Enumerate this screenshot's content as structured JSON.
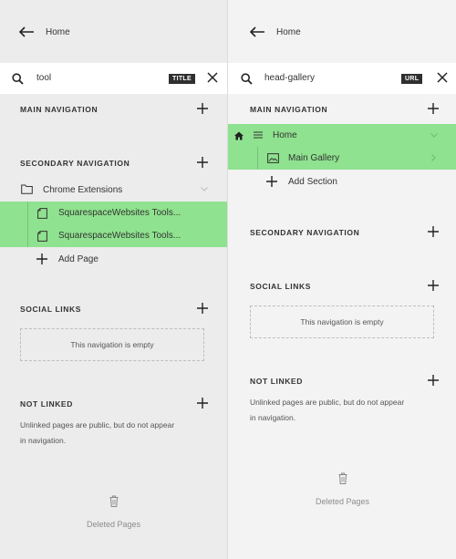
{
  "left": {
    "back_label": "Home",
    "search": {
      "query": "tool",
      "tag": "TITLE"
    },
    "main_nav_header": "MAIN NAVIGATION",
    "secondary_nav_header": "SECONDARY NAVIGATION",
    "folder_label": "Chrome Extensions",
    "pages": [
      "SquarespaceWebsites Tools...",
      "SquarespaceWebsites Tools..."
    ],
    "add_page_label": "Add Page",
    "social_header": "SOCIAL LINKS",
    "empty_text": "This navigation is empty",
    "not_linked_header": "NOT LINKED",
    "not_linked_note_line1": "Unlinked pages are public, but do not appear",
    "not_linked_note_line2": "in navigation.",
    "deleted_label": "Deleted Pages"
  },
  "right": {
    "back_label": "Home",
    "search": {
      "query": "head-gallery",
      "tag": "URL"
    },
    "main_nav_header": "MAIN NAVIGATION",
    "home_label": "Home",
    "gallery_label": "Main Gallery",
    "add_section_label": "Add Section",
    "secondary_nav_header": "SECONDARY NAVIGATION",
    "social_header": "SOCIAL LINKS",
    "empty_text": "This navigation is empty",
    "not_linked_header": "NOT LINKED",
    "not_linked_note_line1": "Unlinked pages are public, but do not appear",
    "not_linked_note_line2": "in navigation.",
    "deleted_label": "Deleted Pages"
  },
  "colors": {
    "highlight": "#8fe28f",
    "tag_bg": "#2f2f2f"
  }
}
